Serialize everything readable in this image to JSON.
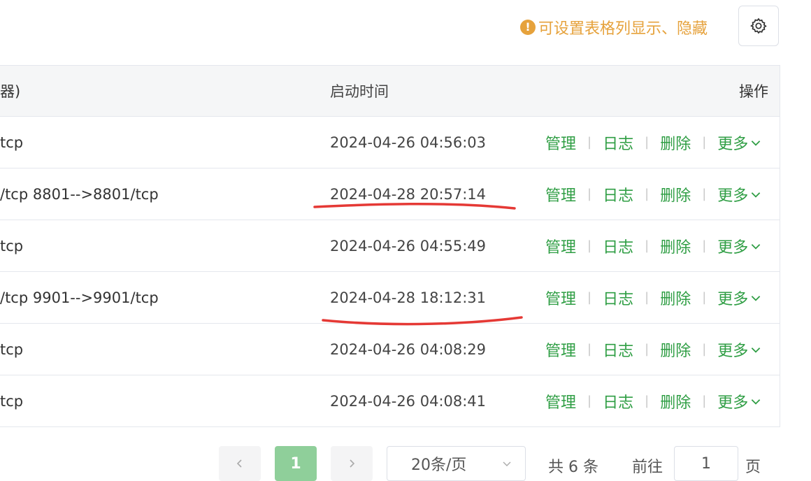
{
  "tip": {
    "text": "可设置表格列显示、隐藏",
    "icon": "warning-icon",
    "color": "#e6a23c"
  },
  "settings_button": {
    "icon": "gear-icon"
  },
  "table": {
    "headers": {
      "ports": "器)",
      "time": "启动时间",
      "ops": "操作"
    },
    "rows": [
      {
        "ports": "tcp",
        "time": "2024-04-26 04:56:03"
      },
      {
        "ports": "/tcp 8801-->8801/tcp",
        "time": "2024-04-28 20:57:14"
      },
      {
        "ports": "tcp",
        "time": "2024-04-26 04:55:49"
      },
      {
        "ports": "/tcp 9901-->9901/tcp",
        "time": "2024-04-28 18:12:31"
      },
      {
        "ports": "tcp",
        "time": "2024-04-26 04:08:29"
      },
      {
        "ports": "tcp",
        "time": "2024-04-26 04:08:41"
      }
    ],
    "actions": {
      "manage": "管理",
      "logs": "日志",
      "delete": "删除",
      "more": "更多"
    },
    "action_color": "#2f9e44"
  },
  "annotations": {
    "underline_color": "#e53935"
  },
  "pagination": {
    "current_page": "1",
    "page_size": "20条/页",
    "total": "共 6 条",
    "goto_label": "前往",
    "goto_value": "1",
    "page_unit": "页"
  }
}
